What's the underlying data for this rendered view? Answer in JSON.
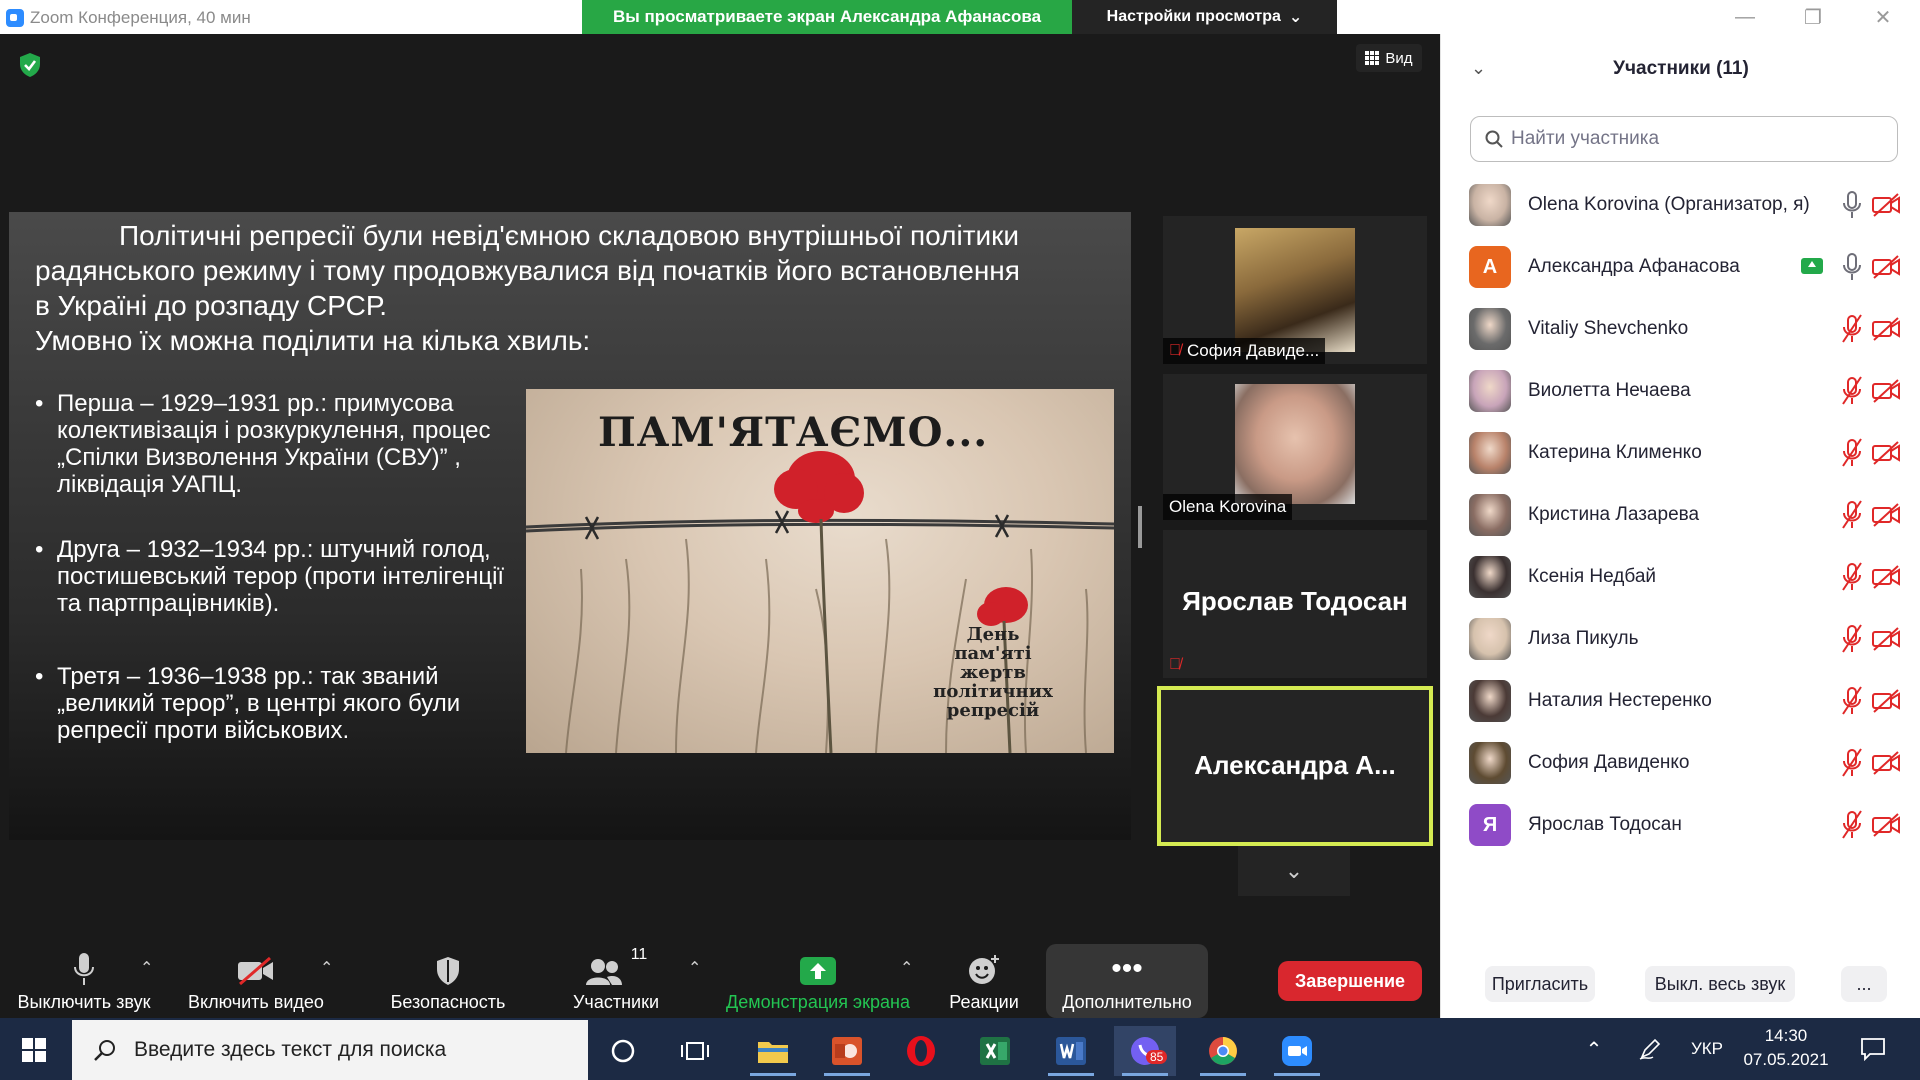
{
  "window": {
    "title": "Zoom Конференция, 40 мин",
    "share_banner": "Вы просматриваете экран Александра Афанасова",
    "view_settings": "Настройки просмотра"
  },
  "meeting": {
    "view_button": "Вид",
    "slide": {
      "intro_lines": [
        "Політичні репресії були невід'ємною складовою внутрішньої політики",
        "радянського режиму і тому продовжувалися від початків його встановлення",
        "в Україні до розпаду СРСР.",
        "Умовно їх можна поділити на кілька хвиль:"
      ],
      "bullets": [
        "Перша – 1929–1931 рр.: примусова колективізація і розкуркулення, процес „Спілки Визволення України (СВУ)” , ліквідація УАПЦ.",
        "Друга – 1932–1934 рр.: штучний голод, постишевський терор (проти інтелігенції та партпрацівників).",
        "Третя – 1936–1938 рр.: так званий „великий терор”, в центрі якого були репресії проти військових."
      ],
      "image_heading": "ПАМ'ЯТАЄМО...",
      "image_caption": [
        "День",
        "пам'яті",
        "жертв",
        "політичних",
        "репресій"
      ]
    },
    "thumbnails": [
      {
        "name": "София Давиде...",
        "muted": true
      },
      {
        "name": "Olena Korovina",
        "muted": false
      },
      {
        "name": "Ярослав Тодосан",
        "muted": true
      },
      {
        "name": "Александра А...",
        "active": true
      }
    ]
  },
  "toolbar": {
    "mute": "Выключить звук",
    "video": "Включить видео",
    "security": "Безопасность",
    "participants": "Участники",
    "participants_count": "11",
    "share": "Демонстрация экрана",
    "reactions": "Реакции",
    "more": "Дополнительно",
    "end": "Завершение"
  },
  "panel": {
    "title": "Участники (11)",
    "search_placeholder": "Найти участника",
    "participants": [
      {
        "name": "Olena Korovina (Организатор, я)",
        "avatar": "photo",
        "color": "#c9b3a4",
        "mic": "on",
        "sharing": false
      },
      {
        "name": "Александра Афанасова",
        "avatar": "letter",
        "initial": "А",
        "color": "#e8661f",
        "mic": "on",
        "sharing": true
      },
      {
        "name": "Vitaliy Shevchenko",
        "avatar": "photo",
        "color": "#6b6b6b",
        "mic": "muted",
        "sharing": false
      },
      {
        "name": "Виолетта Нечаева",
        "avatar": "photo",
        "color": "#c8a4b9",
        "mic": "muted",
        "sharing": false
      },
      {
        "name": "Катерина Клименко",
        "avatar": "photo",
        "color": "#b8826a",
        "mic": "muted",
        "sharing": false
      },
      {
        "name": "Кристина Лазарева",
        "avatar": "photo",
        "color": "#8a6d63",
        "mic": "muted",
        "sharing": false
      },
      {
        "name": "Ксенія Недбай",
        "avatar": "photo",
        "color": "#3a3030",
        "mic": "muted",
        "sharing": false
      },
      {
        "name": "Лиза Пикуль",
        "avatar": "photo",
        "color": "#d6c2ad",
        "mic": "muted",
        "sharing": false
      },
      {
        "name": "Наталия Нестеренко",
        "avatar": "photo",
        "color": "#4b3a36",
        "mic": "muted",
        "sharing": false
      },
      {
        "name": "София Давиденко",
        "avatar": "photo",
        "color": "#5e4b32",
        "mic": "muted",
        "sharing": false
      },
      {
        "name": "Ярослав Тодосан",
        "avatar": "letter",
        "initial": "Я",
        "color": "#8f4bc7",
        "mic": "muted",
        "sharing": false
      }
    ],
    "invite": "Пригласить",
    "mute_all": "Выкл. весь звук",
    "more": "..."
  },
  "taskbar": {
    "search_placeholder": "Введите здесь текст для поиска",
    "viber_badge": "85",
    "language": "УКР",
    "time": "14:30",
    "date": "07.05.2021"
  },
  "colors": {
    "share_green": "#28a745",
    "end_red": "#d9272e",
    "active_border": "#d5eb52",
    "muted_red": "#e02828"
  }
}
